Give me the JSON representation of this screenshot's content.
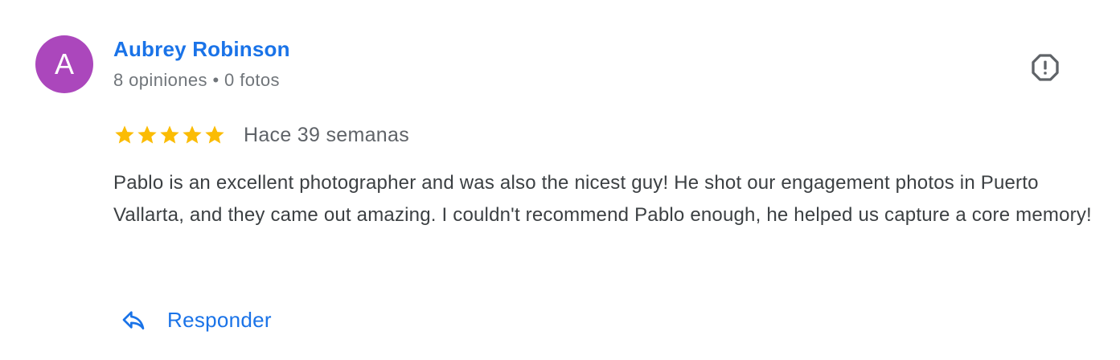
{
  "review": {
    "author": {
      "initial": "A",
      "name": "Aubrey Robinson",
      "meta": "8 opiniones • 0 fotos",
      "avatar_color": "#ab47bc"
    },
    "rating": {
      "stars": 5,
      "max": 5,
      "star_color": "#fbbc04",
      "icon": "star-icon"
    },
    "date": "Hace 39 semanas",
    "text": "Pablo is an excellent photographer and was also the nicest guy! He shot our engagement photos in Puerto Vallarta, and they came out amazing. I couldn't recommend Pablo enough, he helped us capture a core memory!",
    "flag_icon": "report-flag-icon",
    "reply": {
      "label": "Responder",
      "icon": "reply-arrow-icon"
    }
  },
  "colors": {
    "link": "#1a73e8",
    "text": "#3c4043",
    "muted": "#70757a"
  }
}
